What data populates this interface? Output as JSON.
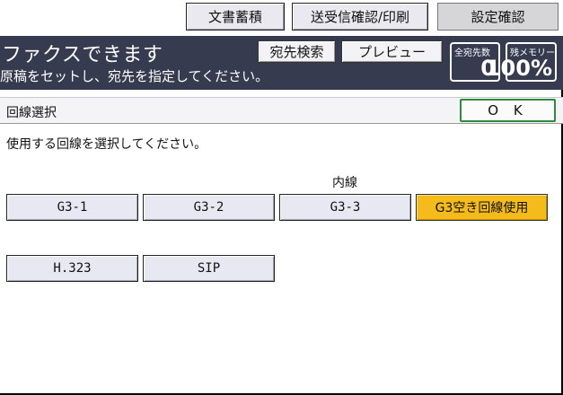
{
  "top_tabs": [
    "文書蓄積",
    "送受信確認/印刷",
    "設定確認"
  ],
  "header": {
    "title": "ファクスできます",
    "subtitle": "原稿をセットし、宛先を指定してください。",
    "dest_search_label": "宛先検索",
    "preview_label": "プレビュー",
    "total_dest_label": "全宛先数",
    "total_dest_value": "0",
    "memory_label": "残メモリー",
    "memory_value": "100%"
  },
  "section": {
    "title": "回線選択",
    "ok_label": "O K"
  },
  "instruction": "使用する回線を選択してください。",
  "group_label": "内線",
  "lines_row1": [
    "G3-1",
    "G3-2",
    "G3-3",
    "G3空き回線使用"
  ],
  "lines_row2": [
    "H.323",
    "SIP"
  ],
  "selected_line": "G3空き回線使用",
  "colors": {
    "header_bg": "#363b50",
    "selected_bg": "#f5bb1a",
    "ok_border": "#2e8b3e",
    "button_bg": "#e8e8f3"
  }
}
